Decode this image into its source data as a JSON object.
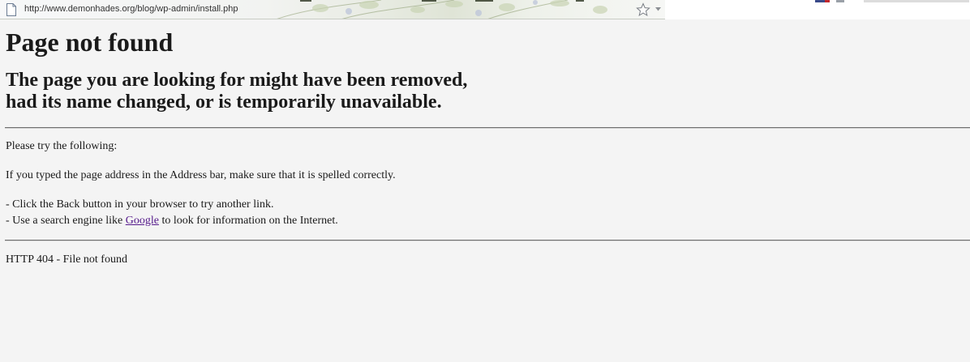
{
  "browser": {
    "url": "http://www.demonhades.org/blog/wp-admin/install.php",
    "icons": [
      "page-icon",
      "star-icon",
      "dropdown-icon"
    ]
  },
  "page": {
    "title": "Page not found",
    "subtitle_line1": "The page you are looking for might have been removed,",
    "subtitle_line2": "had its name changed, or is temporarily unavailable.",
    "try_following": "Please try the following:",
    "address_hint": "If you typed the page address in the Address bar, make sure that it is spelled correctly.",
    "step1": "- Click the Back button in your browser to try another link.",
    "step2_prefix": "- Use a search engine like ",
    "step2_link": "Google",
    "step2_suffix": " to look for information on the Internet.",
    "status": "HTTP 404 - File not found"
  },
  "colors": {
    "background": "#f4f4f4",
    "link_visited": "#551a8b",
    "text": "#1a1a1a"
  }
}
